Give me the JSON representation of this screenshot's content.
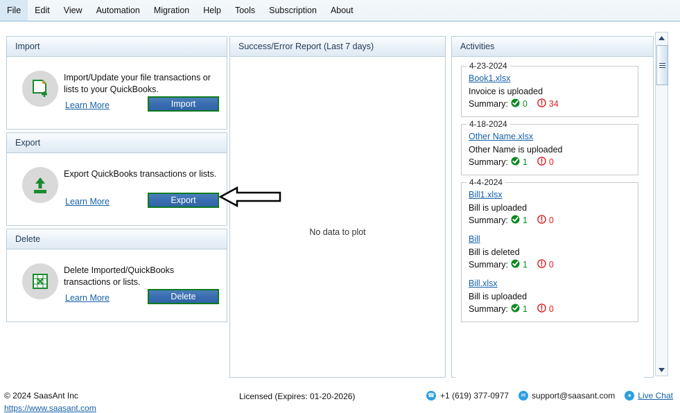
{
  "menu": {
    "items": [
      {
        "label": "File"
      },
      {
        "label": "Edit"
      },
      {
        "label": "View"
      },
      {
        "label": "Automation"
      },
      {
        "label": "Migration"
      },
      {
        "label": "Help"
      },
      {
        "label": "Tools"
      },
      {
        "label": "Subscription"
      },
      {
        "label": "About"
      }
    ]
  },
  "cards": {
    "import": {
      "title": "Import",
      "description": "Import/Update your file transactions or lists to your QuickBooks.",
      "learn_more": "Learn More",
      "button": "Import",
      "icon": "document-plus-icon"
    },
    "export": {
      "title": "Export",
      "description": "Export QuickBooks transactions or lists.",
      "learn_more": "Learn More",
      "button": "Export",
      "icon": "upload-arrow-icon"
    },
    "delete": {
      "title": "Delete",
      "description": "Delete Imported/QuickBooks transactions or lists.",
      "learn_more": "Learn More",
      "button": "Delete",
      "icon": "spreadsheet-x-icon"
    }
  },
  "report": {
    "title": "Success/Error Report (Last 7 days)",
    "empty_message": "No data to plot"
  },
  "activities": {
    "title": "Activities",
    "summary_label": "Summary:",
    "groups": [
      {
        "date": "4-23-2024",
        "entries": [
          {
            "file": "Book1.xlsx",
            "description": "Invoice is uploaded",
            "success": "0",
            "error": "34"
          }
        ]
      },
      {
        "date": "4-18-2024",
        "entries": [
          {
            "file": "Other Name.xlsx",
            "description": "Other Name is uploaded",
            "success": "1",
            "error": "0"
          }
        ]
      },
      {
        "date": "4-4-2024",
        "entries": [
          {
            "file": "Bill1.xlsx",
            "description": "Bill is uploaded",
            "success": "1",
            "error": "0"
          },
          {
            "file": "Bill",
            "description": "Bill is deleted",
            "success": "1",
            "error": "0"
          },
          {
            "file": "Bill.xlsx",
            "description": "Bill is uploaded",
            "success": "1",
            "error": "0"
          }
        ]
      }
    ]
  },
  "scrollbar": {
    "up_icon": "triangle-up-icon",
    "down_icon": "triangle-down-icon",
    "thumb_icon": "grip-lines-icon"
  },
  "annotation": {
    "arrow_icon": "left-arrow-annotation",
    "points_to": "Export"
  },
  "footer": {
    "copyright": "©  2024  SaasAnt Inc",
    "url": "https://www.saasant.com",
    "license": "Licensed  (Expires: 01-20-2026)",
    "phone": "+1 (619) 377-0977",
    "email": "support@saasant.com",
    "live_chat": "Live Chat",
    "phone_icon": "phone-icon",
    "email_icon": "envelope-icon",
    "chat_icon": "chat-bubble-icon"
  },
  "colors": {
    "accent_blue": "#3a6db0",
    "link_blue": "#1661a8",
    "success_green": "#0a8a20",
    "error_red": "#d92121",
    "button_border_green": "#0d7a1e"
  }
}
